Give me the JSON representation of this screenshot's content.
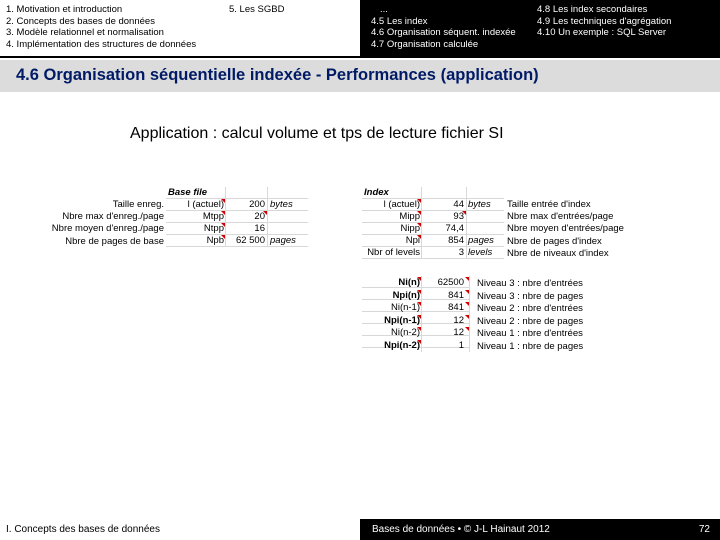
{
  "nav": {
    "left_items": [
      "1. Motivation et introduction",
      "2. Concepts des bases de données",
      "3. Modèle relationnel et normalisation",
      "4. Implémentation des structures de données"
    ],
    "left_extra": "5. Les SGBD",
    "right_col1": [
      "...",
      "4.5 Les index",
      "4.6 Organisation séquent. indexée",
      "4.7 Organisation calculée"
    ],
    "right_col2": [
      "4.8 Les index secondaires",
      "4.9 Les techniques d'agrégation",
      "4.10 Un exemple : SQL Server"
    ]
  },
  "title": "4.6 Organisation séquentielle indexée - Performances (application)",
  "subtitle": {
    "strong": "Application",
    "rest": " : calcul volume et tps de lecture fichier SI"
  },
  "base_file": {
    "header": "Base file",
    "row_labels": [
      "Taille enreg.",
      "Nbre max d'enreg./page",
      "Nbre moyen d'enreg./page",
      "Nbre de pages de base"
    ],
    "rows": [
      {
        "name": "l (actuel)",
        "value": "200",
        "unit": "bytes"
      },
      {
        "name": "Mtpp",
        "value": "20",
        "unit": ""
      },
      {
        "name": "Ntpp",
        "value": "16",
        "unit": ""
      },
      {
        "name": "Npb",
        "value": "62 500",
        "unit": "pages"
      }
    ]
  },
  "index": {
    "header": "Index",
    "rows": [
      {
        "name": "l (actuel)",
        "value": "44",
        "unit": "bytes"
      },
      {
        "name": "Mipp",
        "value": "93",
        "unit": ""
      },
      {
        "name": "Nipp",
        "value": "74,4",
        "unit": ""
      },
      {
        "name": "Npi",
        "value": "854",
        "unit": "pages"
      },
      {
        "name": "Nbr of levels",
        "value": "3",
        "unit": "levels"
      }
    ],
    "notes": [
      "Taille entrée d'index",
      "Nbre max d'entrées/page",
      "Nbre moyen d'entrées/page",
      "Nbre de pages d'index",
      "Nbre de niveaux d'index"
    ]
  },
  "levels": {
    "rows": [
      {
        "name": "Ni(n)",
        "value": "62500"
      },
      {
        "name": "Npi(n)",
        "value": "841"
      },
      {
        "name": "Ni(n-1)",
        "value": "841"
      },
      {
        "name": "Npi(n-1)",
        "value": "12"
      },
      {
        "name": "Ni(n-2)",
        "value": "12"
      },
      {
        "name": "Npi(n-2)",
        "value": "1"
      }
    ],
    "notes": [
      "Niveau 3 : nbre d'entrées",
      "Niveau 3 : nbre de pages",
      "Niveau 2 : nbre d'entrées",
      "Niveau 2 : nbre de pages",
      "Niveau 1 : nbre d'entrées",
      "Niveau 1 : nbre de pages"
    ]
  },
  "footer": {
    "left": "I. Concepts des bases de données",
    "center": "Bases de données • © J-L Hainaut 2012",
    "page": "72"
  }
}
